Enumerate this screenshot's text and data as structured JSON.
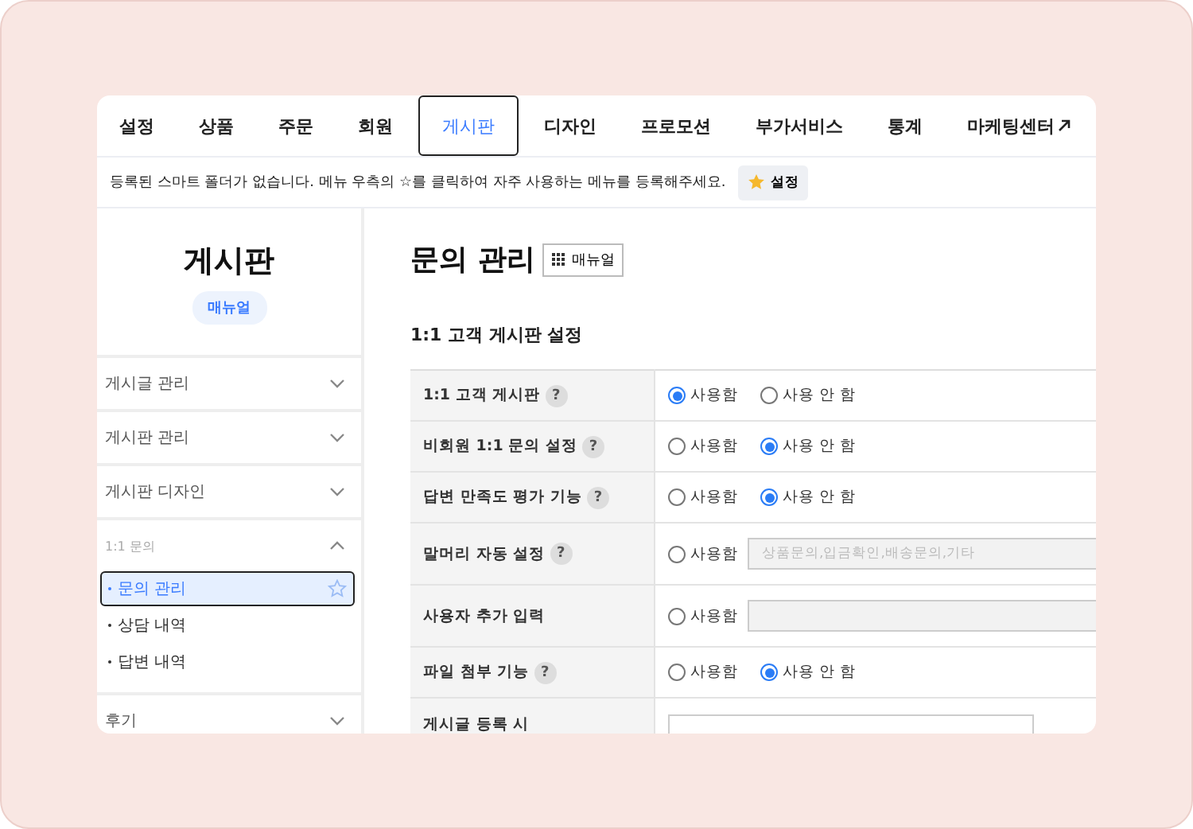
{
  "nav": {
    "items": [
      {
        "label": "설정",
        "selected": false
      },
      {
        "label": "상품",
        "selected": false
      },
      {
        "label": "주문",
        "selected": false
      },
      {
        "label": "회원",
        "selected": false
      },
      {
        "label": "게시판",
        "selected": true
      },
      {
        "label": "디자인",
        "selected": false
      },
      {
        "label": "프로모션",
        "selected": false
      },
      {
        "label": "부가서비스",
        "selected": false
      },
      {
        "label": "통계",
        "selected": false
      },
      {
        "label": "마케팅센터",
        "selected": false,
        "external": true
      }
    ]
  },
  "notice": {
    "text": "등록된 스마트 폴더가 없습니다. 메뉴 우측의 ☆를 클릭하여 자주 사용하는 메뉴를 등록해주세요.",
    "button": "설정"
  },
  "sidebar": {
    "title": "게시판",
    "manual": "매뉴얼",
    "items": [
      {
        "label": "게시글 관리",
        "expanded": false
      },
      {
        "label": "게시판 관리",
        "expanded": false
      },
      {
        "label": "게시판 디자인",
        "expanded": false
      },
      {
        "label": "1:1 문의",
        "expanded": true,
        "children": [
          {
            "label": "문의 관리",
            "selected": true
          },
          {
            "label": "상담 내역",
            "selected": false
          },
          {
            "label": "답변 내역",
            "selected": false
          }
        ]
      },
      {
        "label": "후기",
        "expanded": false
      }
    ]
  },
  "page": {
    "title": "문의 관리",
    "manual": "매뉴얼",
    "section": "1:1 고객 게시판 설정",
    "rows": [
      {
        "kind": "radio",
        "label": "1:1 고객 게시판",
        "help": "?",
        "options": [
          {
            "label": "사용함",
            "selected": true
          },
          {
            "label": "사용 안 함",
            "selected": false
          }
        ]
      },
      {
        "kind": "radio",
        "label": "비회원 1:1 문의 설정",
        "help": "?",
        "options": [
          {
            "label": "사용함",
            "selected": false
          },
          {
            "label": "사용 안 함",
            "selected": true
          }
        ]
      },
      {
        "kind": "radio",
        "label": "답변 만족도 평가 기능",
        "help": "?",
        "options": [
          {
            "label": "사용함",
            "selected": false
          },
          {
            "label": "사용 안 함",
            "selected": true
          }
        ]
      },
      {
        "kind": "radio-input",
        "label": "말머리 자동 설정",
        "help": "?",
        "options": [
          {
            "label": "사용함",
            "selected": false
          }
        ],
        "placeholder": "상품문의,입금확인,배송문의,기타"
      },
      {
        "kind": "radio-input",
        "label": "사용자 추가 입력",
        "options": [
          {
            "label": "사용함",
            "selected": false
          }
        ]
      },
      {
        "kind": "radio",
        "label": "파일 첨부 기능",
        "help": "?",
        "options": [
          {
            "label": "사용함",
            "selected": false
          },
          {
            "label": "사용 안 함",
            "selected": true
          }
        ]
      },
      {
        "kind": "textarea",
        "label": "게시글 등록 시"
      }
    ]
  }
}
